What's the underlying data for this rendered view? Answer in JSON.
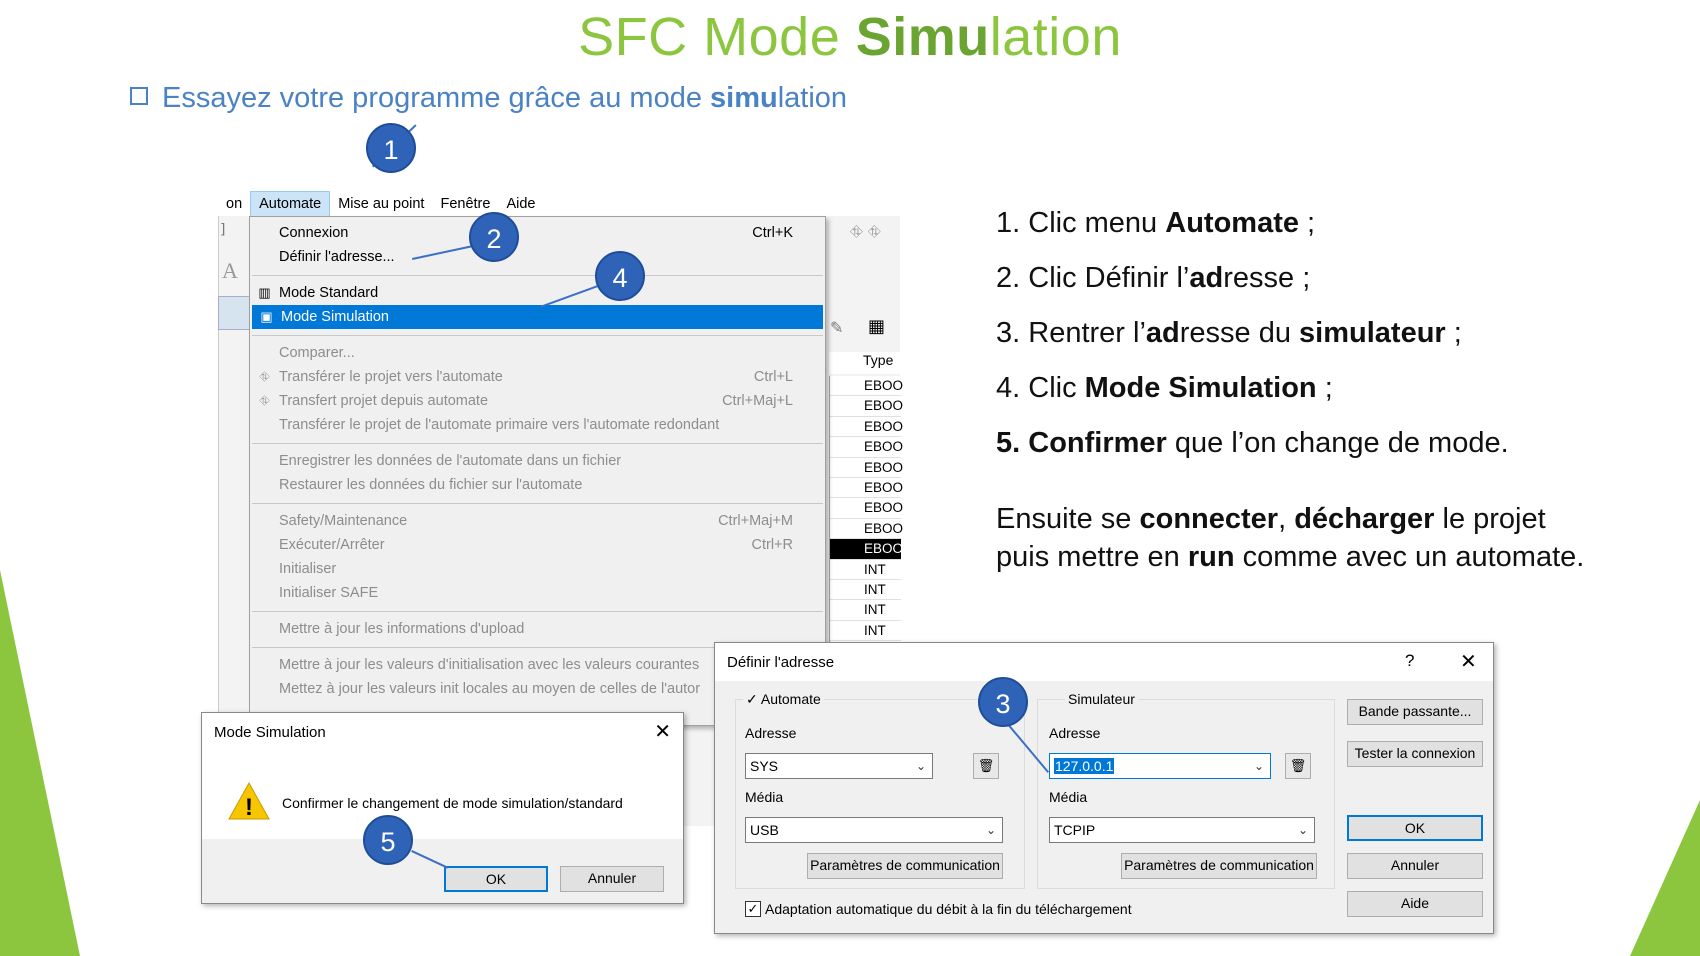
{
  "slide": {
    "title_pre": "SFC Mode ",
    "title_bold": "Simu",
    "title_post": "lation",
    "subtitle_pre": "Essayez votre programme grâce au mode ",
    "subtitle_bold": "simu",
    "subtitle_post": "lation"
  },
  "steps": [
    {
      "num": "1.",
      "pre": "Clic menu ",
      "bold": "Automate",
      "post": " ;"
    },
    {
      "num": "2.",
      "pre": "Clic Définir l’",
      "bold": "ad",
      "post": "resse ;"
    },
    {
      "num": "3.",
      "pre": "Rentrer l’",
      "bold": "ad",
      "post": "resse du ",
      "bold2": "simulateur",
      "post2": " ;"
    },
    {
      "num": "4.",
      "pre": "Clic ",
      "bold": "Mode Simulation",
      "post": " ;"
    },
    {
      "num": "5.",
      "pre": "",
      "bold": "Confirmer",
      "post": " que l’on change de mode."
    }
  ],
  "after": {
    "l1_pre": "Ensuite se ",
    "l1_b1": "connecter",
    "l1_mid": ", ",
    "l1_b2": "décharger",
    "l1_post": " le projet",
    "l2_pre": "puis mettre en ",
    "l2_b": "run",
    "l2_post": " comme avec un automate."
  },
  "menubar": {
    "items": [
      "on",
      "Automate",
      "Mise au point",
      "Fenêtre",
      "Aide"
    ]
  },
  "menu": {
    "connexion": "Connexion",
    "connexion_sc": "Ctrl+K",
    "definir": "Définir l'adresse...",
    "mode_standard": "Mode Standard",
    "mode_simulation": "Mode Simulation",
    "comparer": "Comparer...",
    "transferer": "Transférer le projet vers l'automate",
    "transferer_sc": "Ctrl+L",
    "transfert_depuis": "Transfert projet depuis automate",
    "transfert_depuis_sc": "Ctrl+Maj+L",
    "transferer_redondant": "Transférer le projet de l'automate primaire vers l'automate redondant",
    "enregistrer": "Enregistrer les données de l'automate dans un fichier",
    "restaurer": "Restaurer les données du fichier sur l'automate",
    "safety": "Safety/Maintenance",
    "safety_sc": "Ctrl+Maj+M",
    "executer": "Exécuter/Arrêter",
    "executer_sc": "Ctrl+R",
    "initialiser": "Initialiser",
    "initialiser_safe": "Initialiser SAFE",
    "maj_upload": "Mettre à jour les informations d'upload",
    "maj_init": "Mettre à jour les valeurs d'initialisation avec les valeurs courantes",
    "maj_init_locales": "Mettez à jour les valeurs init locales au moyen de celles de l'autor"
  },
  "type_column": {
    "header": "Type",
    "values": [
      "EBOO",
      "EBOO",
      "EBOO",
      "EBOO",
      "EBOO",
      "EBOO",
      "EBOO",
      "EBOO",
      "EBOO",
      "INT",
      "INT",
      "INT",
      "INT"
    ]
  },
  "callouts": [
    "1",
    "2",
    "3",
    "4",
    "5"
  ],
  "confirm_dialog": {
    "title": "Mode Simulation",
    "message": "Confirmer le changement de mode simulation/standard",
    "ok": "OK",
    "cancel": "Annuler"
  },
  "address_dialog": {
    "title": "Définir l'adresse",
    "help": "?",
    "close": "✕",
    "automate_label": "Automate",
    "adresse_label": "Adresse",
    "adresse_value": "SYS",
    "media_label": "Média",
    "media_value": "USB",
    "params_btn": "Paramètres de communication",
    "sim_label": "Simulateur",
    "sim_adresse_label": "Adresse",
    "sim_adresse_value": "127.0.0.1",
    "sim_media_label": "Média",
    "sim_media_value": "TCPIP",
    "sim_params_btn": "Paramètres de communication",
    "bande": "Bande passante...",
    "tester": "Tester la connexion",
    "ok": "OK",
    "annuler": "Annuler",
    "aide": "Aide",
    "adaptation": "Adaptation automatique du débit à la fin du téléchargement"
  },
  "colors": {
    "title_green": "#8cc63f",
    "subtitle_blue": "#4a82c6",
    "callout_blue": "#2f63b8",
    "highlight": "#0078d7"
  }
}
